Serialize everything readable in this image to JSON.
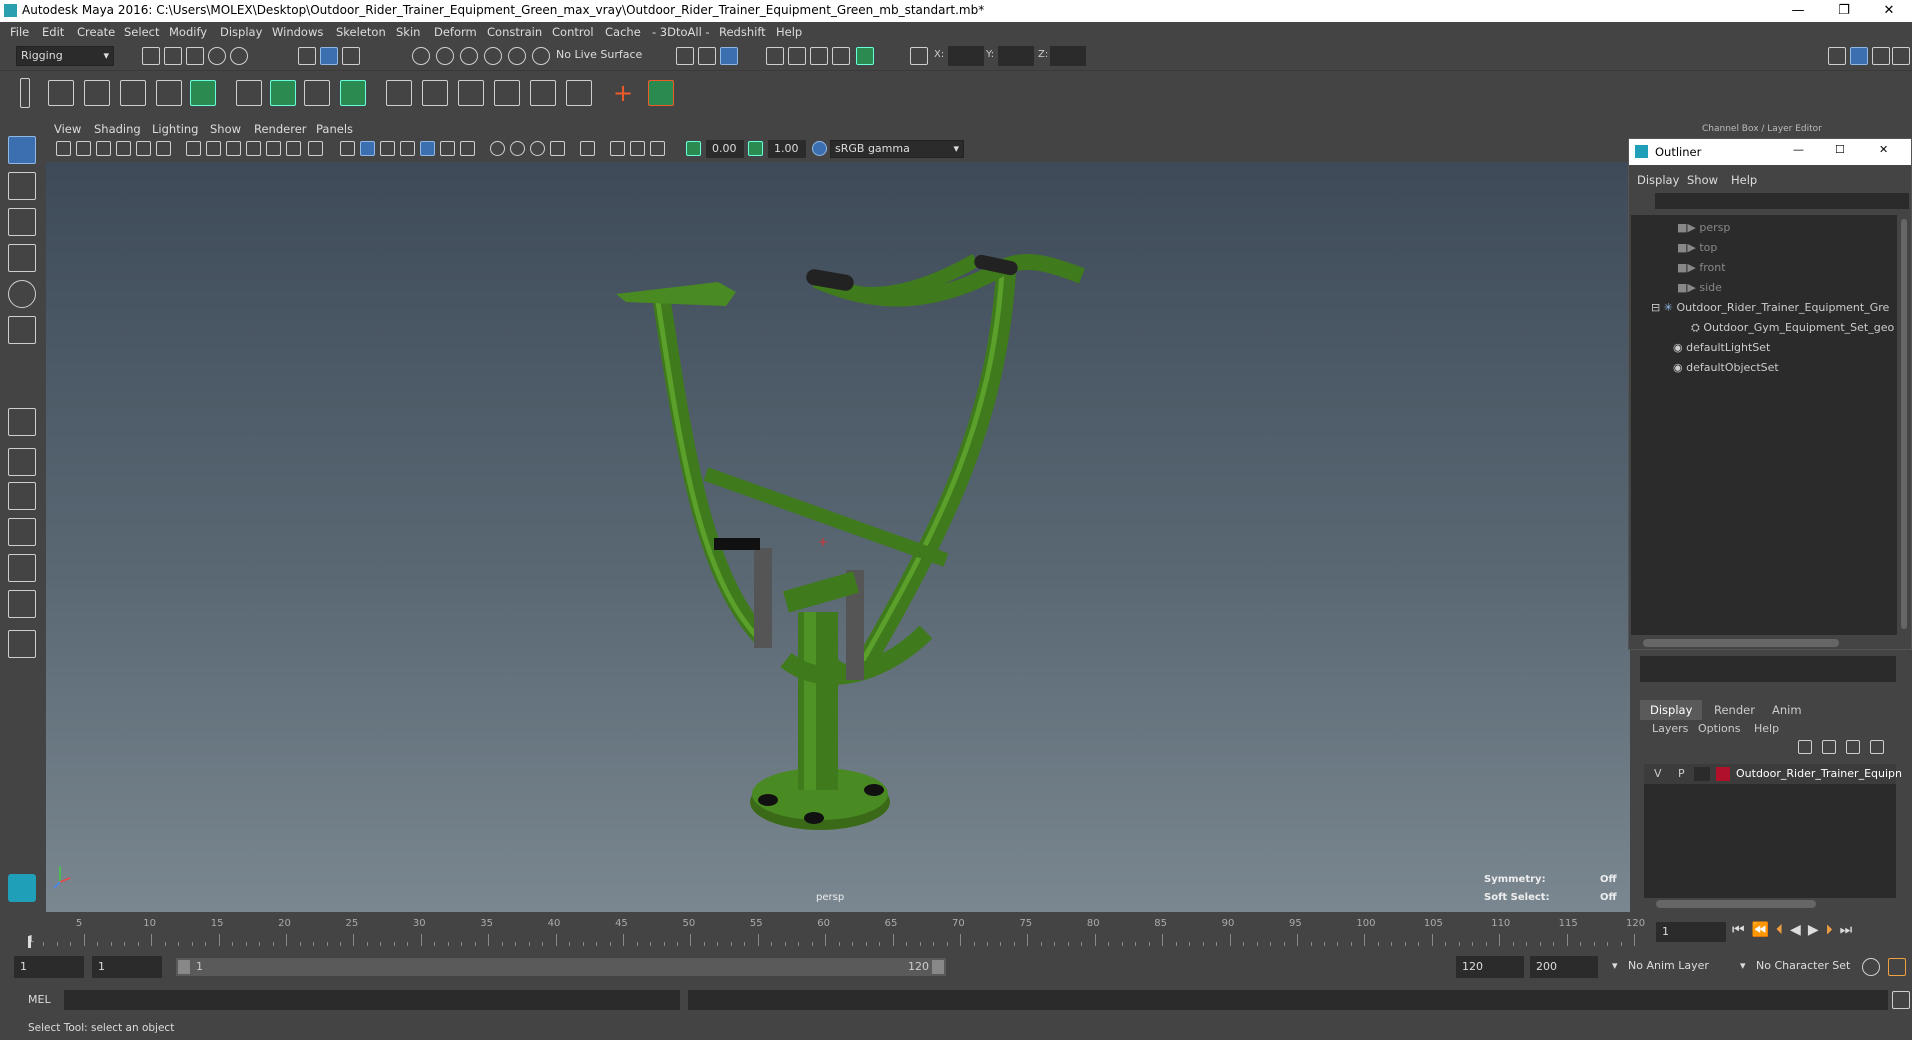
{
  "window": {
    "title": "Autodesk Maya 2016: C:\\Users\\MOLEX\\Desktop\\Outdoor_Rider_Trainer_Equipment_Green_max_vray\\Outdoor_Rider_Trainer_Equipment_Green_mb_standart.mb*",
    "minimize": "—",
    "restore": "❐",
    "close": "✕"
  },
  "menubar": [
    "File",
    "Edit",
    "Create",
    "Select",
    "Modify",
    "Display",
    "Windows",
    "Skeleton",
    "Skin",
    "Deform",
    "Constrain",
    "Control",
    "Cache",
    "- 3DtoAll -",
    "Redshift",
    "Help"
  ],
  "statusline": {
    "mode": "Rigging",
    "live_surface": "No Live Surface",
    "x_label": "X:",
    "y_label": "Y:",
    "z_label": "Z:"
  },
  "viewport": {
    "menu": [
      "View",
      "Shading",
      "Lighting",
      "Show",
      "Renderer",
      "Panels"
    ],
    "exposure": "0.00",
    "gamma": "1.00",
    "colorspace": "sRGB gamma",
    "camera_label": "persp",
    "symmetry_label": "Symmetry:",
    "symmetry_value": "Off",
    "soft_select_label": "Soft Select:",
    "soft_select_value": "Off"
  },
  "right_panel_title": "Channel Box / Layer Editor",
  "outliner": {
    "title": "Outliner",
    "menu": [
      "Display",
      "Show",
      "Help"
    ],
    "items": [
      {
        "label": "persp",
        "dim": true
      },
      {
        "label": "top",
        "dim": true
      },
      {
        "label": "front",
        "dim": true
      },
      {
        "label": "side",
        "dim": true
      },
      {
        "label": "Outdoor_Rider_Trainer_Equipment_Gre",
        "dim": false
      },
      {
        "label": "Outdoor_Gym_Equipment_Set_geo",
        "dim": false
      },
      {
        "label": "defaultLightSet",
        "dim": false
      },
      {
        "label": "defaultObjectSet",
        "dim": false
      }
    ]
  },
  "layer_editor": {
    "tabs": [
      "Display",
      "Render",
      "Anim"
    ],
    "menu": [
      "Layers",
      "Options",
      "Help"
    ],
    "layer": {
      "v": "V",
      "p": "P",
      "name": "Outdoor_Rider_Trainer_Equipn",
      "color": "#b0102a"
    }
  },
  "timeline": {
    "ticks": [
      5,
      10,
      15,
      20,
      25,
      30,
      35,
      40,
      45,
      50,
      55,
      60,
      65,
      70,
      75,
      80,
      85,
      90,
      95,
      100,
      105,
      110,
      115,
      120
    ],
    "start_label": "1",
    "current_frame": "1"
  },
  "range": {
    "start": "1",
    "playback_start": "1",
    "slider_start": "1",
    "slider_end": "120",
    "playback_end": "120",
    "end": "200",
    "anim_layer": "No Anim Layer",
    "character_set": "No Character Set"
  },
  "command": {
    "label": "MEL"
  },
  "helpline": "Select Tool: select an object",
  "colors": {
    "accent": "#5285c4",
    "model_green": "#4a8a22",
    "layer_red": "#b0102a"
  }
}
